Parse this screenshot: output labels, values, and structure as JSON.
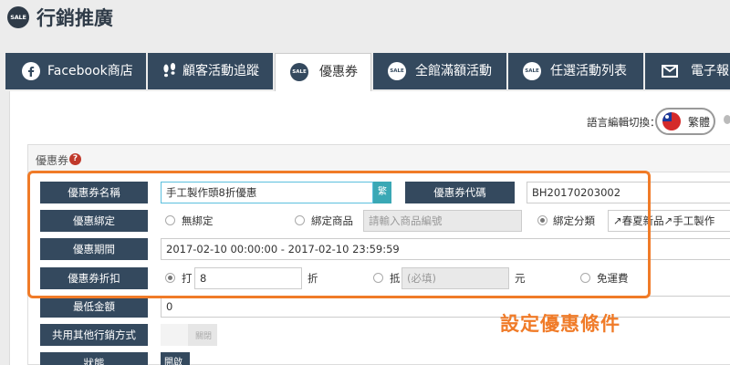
{
  "header": {
    "title": "行銷推廣",
    "badge_text": "SALE"
  },
  "tabs": [
    {
      "label": "Facebook商店",
      "icon": "facebook-icon"
    },
    {
      "label": "顧客活動追蹤",
      "icon": "footprints-icon"
    },
    {
      "label": "優惠券",
      "icon": "sale-icon",
      "active": true
    },
    {
      "label": "全館滿額活動",
      "icon": "sale-icon"
    },
    {
      "label": "任選活動列表",
      "icon": "sale-icon"
    },
    {
      "label": "電子報",
      "icon": "envelope-icon"
    }
  ],
  "language": {
    "label": "語言編輯切換：",
    "current": "繁體",
    "flag": "taiwan-flag-icon"
  },
  "panel": {
    "title": "優惠券",
    "help_icon": "question-icon"
  },
  "form": {
    "coupon_name": {
      "label": "優惠券名稱",
      "value": "手工製作頭8折優惠",
      "lang_button": "繁"
    },
    "coupon_code": {
      "label": "優惠券代碼",
      "value": "BH20170203002"
    },
    "binding": {
      "label": "優惠綁定",
      "option_none": "無綁定",
      "option_product": "綁定商品",
      "product_placeholder": "請輸入商品編號",
      "option_category": "綁定分類",
      "category_value": "↗春夏新品↗手工製作",
      "selected": "綁定分類"
    },
    "period": {
      "label": "優惠期間",
      "value": "2017-02-10 00:00:00 - 2017-02-10 23:59:59"
    },
    "discount": {
      "label": "優惠券折扣",
      "percent_prefix": "打",
      "percent_value": "8",
      "percent_suffix": "折",
      "amount_prefix": "抵",
      "amount_placeholder": "(必填)",
      "amount_suffix": "元",
      "free_shipping": "免運費",
      "selected": "打"
    },
    "min_amount": {
      "label": "最低金額",
      "value": "0"
    },
    "combine": {
      "label": "共用其他行銷方式",
      "value": "關閉"
    },
    "status": {
      "label": "狀態",
      "value": "開啟"
    }
  },
  "annotation": {
    "text": "設定優惠條件",
    "color": "#f07b28"
  },
  "colors": {
    "navy": "#34495e",
    "accent": "#f07b28",
    "teal": "#3aa8b5"
  }
}
